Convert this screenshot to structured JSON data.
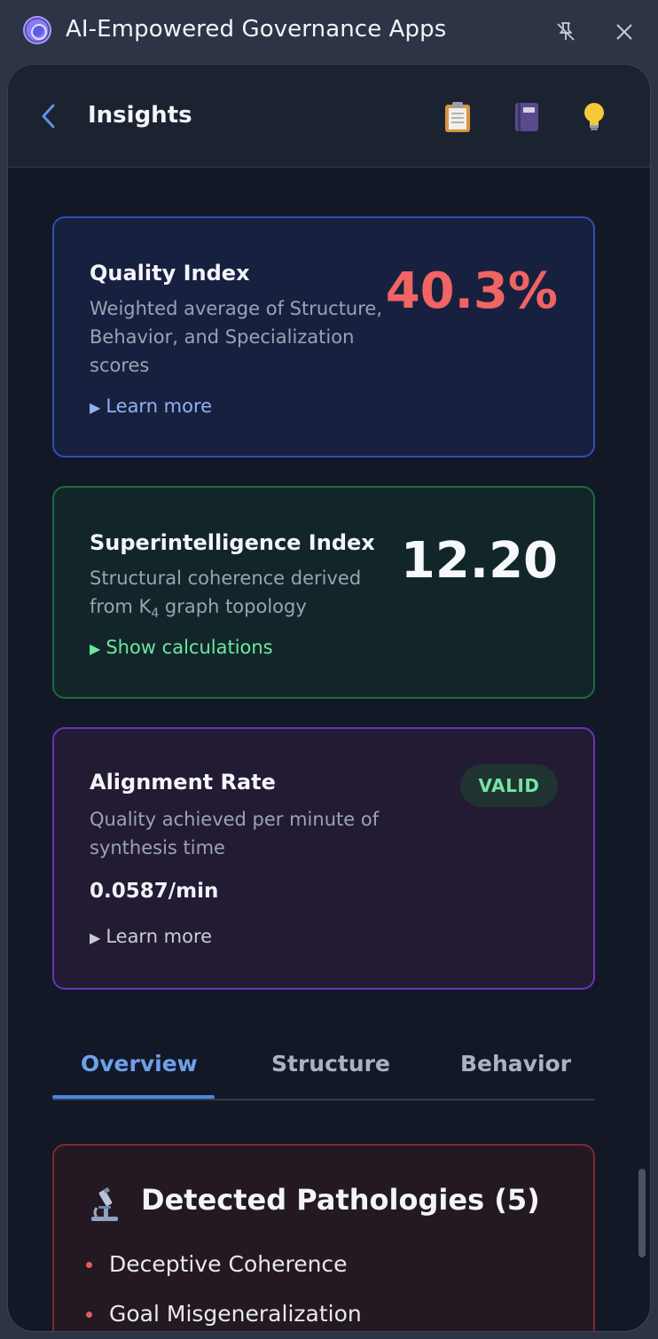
{
  "window": {
    "title": "AI-Empowered Governance Apps"
  },
  "header": {
    "title": "Insights",
    "icons": [
      "clipboard-icon",
      "notebook-icon",
      "lightbulb-icon"
    ]
  },
  "quality": {
    "title": "Quality Index",
    "description": "Weighted average of Structure, Behavior, and Specialization scores",
    "value": "40.3%",
    "link": "Learn more",
    "value_color": "#f06464"
  },
  "superintelligence": {
    "title": "Superintelligence Index",
    "description_pre": "Structural coherence derived from K",
    "description_sub": "4",
    "description_post": " graph topology",
    "value": "12.20",
    "link": "Show calculations"
  },
  "alignment": {
    "title": "Alignment Rate",
    "description": "Quality achieved per minute of synthesis time",
    "rate": "0.0587/min",
    "badge": "VALID",
    "link": "Learn more"
  },
  "tabs": {
    "overview": "Overview",
    "structure": "Structure",
    "behavior": "Behavior",
    "active": "Overview"
  },
  "pathologies": {
    "title": "Detected Pathologies (5)",
    "items": [
      "Deceptive Coherence",
      "Goal Misgeneralization"
    ]
  },
  "colors": {
    "accent": "#4a86e0",
    "success": "#76e3a4",
    "danger": "#e15b5b"
  }
}
